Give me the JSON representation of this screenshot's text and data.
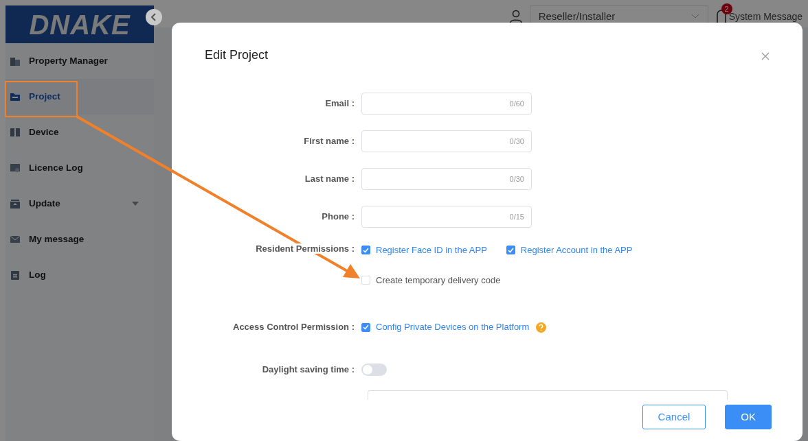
{
  "logo": "DNAKE",
  "sidebar": {
    "items": [
      {
        "label": "Property Manager",
        "selected": false,
        "expandable": false
      },
      {
        "label": "Project",
        "selected": true,
        "expandable": false
      },
      {
        "label": "Device",
        "selected": false,
        "expandable": false
      },
      {
        "label": "Licence Log",
        "selected": false,
        "expandable": false
      },
      {
        "label": "Update",
        "selected": false,
        "expandable": true
      },
      {
        "label": "My message",
        "selected": false,
        "expandable": false
      },
      {
        "label": "Log",
        "selected": false,
        "expandable": false
      }
    ]
  },
  "header": {
    "role_select": "Reseller/Installer",
    "notification_count": "2",
    "notification_label": "System Message"
  },
  "dialog": {
    "title": "Edit Project",
    "fields": [
      {
        "label": "Email :",
        "counter": "0/60"
      },
      {
        "label": "First name :",
        "counter": "0/30"
      },
      {
        "label": "Last name :",
        "counter": "0/30"
      },
      {
        "label": "Phone :",
        "counter": "0/15"
      }
    ],
    "resident_permissions": {
      "label": "Resident Permissions :",
      "options": [
        {
          "label": "Register Face ID in the APP",
          "checked": true
        },
        {
          "label": "Register Account in the APP",
          "checked": true
        },
        {
          "label": "Create temporary delivery code",
          "checked": false
        }
      ]
    },
    "access_control": {
      "label": "Access Control Permission :",
      "options": [
        {
          "label": "Config Private Devices on the Platform",
          "checked": true
        }
      ]
    },
    "daylight_saving": {
      "label": "Daylight saving time :",
      "on": false
    },
    "buttons": [
      {
        "label": "Cancel",
        "kind": "secondary"
      },
      {
        "label": "OK",
        "kind": "primary"
      }
    ]
  }
}
